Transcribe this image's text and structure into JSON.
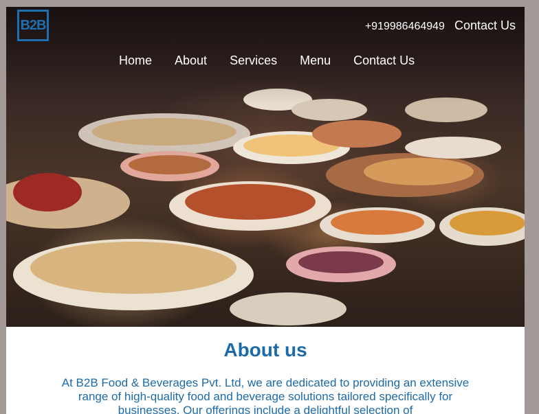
{
  "brand": {
    "logo_text": "B2B",
    "accent_color": "#1c6aa8"
  },
  "header": {
    "phone": "+919986464949",
    "contact_label": "Contact Us"
  },
  "nav": {
    "items": [
      {
        "label": "Home"
      },
      {
        "label": "About"
      },
      {
        "label": "Services"
      },
      {
        "label": "Menu"
      },
      {
        "label": "Contact Us"
      }
    ]
  },
  "about": {
    "heading": "About us",
    "body": "At B2B Food & Beverages Pvt. Ltd, we are dedicated to providing an extensive range of high-quality food and beverage solutions tailored specifically for businesses. Our offerings include a delightful selection of"
  }
}
